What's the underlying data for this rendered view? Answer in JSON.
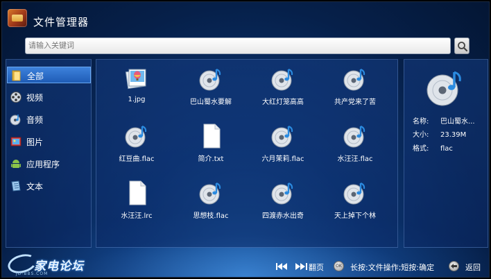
{
  "app": {
    "title": "文件管理器"
  },
  "search": {
    "placeholder": "请输入关键词"
  },
  "sidebar": {
    "items": [
      {
        "label": "全部",
        "icon": "folder-icon",
        "active": true
      },
      {
        "label": "视频",
        "icon": "film-reel-icon",
        "active": false
      },
      {
        "label": "音频",
        "icon": "music-disc-icon",
        "active": false
      },
      {
        "label": "图片",
        "icon": "image-icon",
        "active": false
      },
      {
        "label": "应用程序",
        "icon": "android-icon",
        "active": false
      },
      {
        "label": "文本",
        "icon": "text-document-icon",
        "active": false
      }
    ]
  },
  "files": [
    {
      "name": "1.jpg",
      "type": "image"
    },
    {
      "name": "巴山蜀水要解",
      "type": "audio"
    },
    {
      "name": "大红灯笼高高",
      "type": "audio"
    },
    {
      "name": "共产党来了苦",
      "type": "audio"
    },
    {
      "name": "红豆曲.flac",
      "type": "audio"
    },
    {
      "name": "简介.txt",
      "type": "text"
    },
    {
      "name": "六月茉莉.flac",
      "type": "audio"
    },
    {
      "name": "水汪汪.flac",
      "type": "audio"
    },
    {
      "name": "水汪汪.lrc",
      "type": "text"
    },
    {
      "name": "思想枝.flac",
      "type": "audio"
    },
    {
      "name": "四渡赤水出奇",
      "type": "audio"
    },
    {
      "name": "天上掉下个林",
      "type": "audio"
    }
  ],
  "details": {
    "name_label": "名称:",
    "name_value": "巴山蜀水...",
    "size_label": "大小:",
    "size_value": "23.39M",
    "format_label": "格式:",
    "format_value": "flac"
  },
  "footer": {
    "logo_text": "家电论坛",
    "logo_sub": "JD-BBS.COM",
    "page_hint": "翻页",
    "ok_label": "OK",
    "ok_hint": "长按:文件操作;短按:确定",
    "back_hint": "返回"
  },
  "colors": {
    "background": "#0c3674",
    "accent": "#2f74d0",
    "selection": "#3d82dc"
  }
}
